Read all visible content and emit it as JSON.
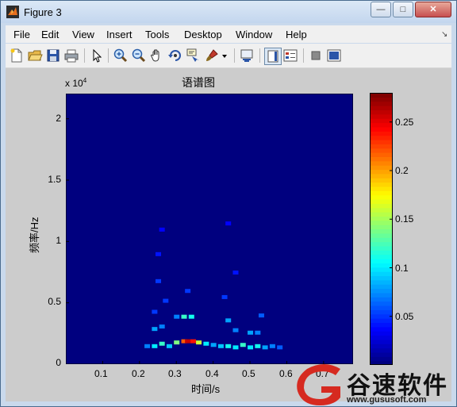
{
  "window": {
    "title": "Figure 3",
    "minimize_label": "—",
    "maximize_label": "□",
    "close_label": "✕"
  },
  "menubar": {
    "items": [
      "File",
      "Edit",
      "View",
      "Insert",
      "Tools",
      "Desktop",
      "Window",
      "Help"
    ],
    "dock_arrow": "↘"
  },
  "toolbar": {
    "buttons": [
      "new-figure-icon",
      "open-file-icon",
      "save-icon",
      "print-icon",
      "select-pointer-icon",
      "zoom-in-icon",
      "zoom-out-icon",
      "pan-hand-icon",
      "rotate-3d-icon",
      "data-cursor-icon",
      "brush-icon",
      "link-plot-icon",
      "colorbar-icon",
      "legend-icon",
      "hide-plot-tools-icon",
      "show-plot-tools-icon"
    ]
  },
  "chart_data": {
    "type": "heatmap",
    "title": "语谱图",
    "xlabel": "时间/s",
    "ylabel": "频率/Hz",
    "y_exponent_label": "x 10",
    "y_exponent": "4",
    "xlim": [
      0,
      0.78
    ],
    "ylim": [
      0,
      22050
    ],
    "x_ticks": [
      "0.1",
      "0.2",
      "0.3",
      "0.4",
      "0.5",
      "0.6",
      "0.7"
    ],
    "x_tick_values": [
      0.1,
      0.2,
      0.3,
      0.4,
      0.5,
      0.6,
      0.7
    ],
    "y_ticks": [
      "0",
      "0.5",
      "1",
      "1.5",
      "2"
    ],
    "y_tick_values": [
      0,
      5000,
      10000,
      15000,
      20000
    ],
    "colormap": "jet",
    "background_color": "#00007f",
    "colorbar": {
      "range": [
        0,
        0.28
      ],
      "ticks": [
        "0.05",
        "0.1",
        "0.15",
        "0.2",
        "0.25"
      ],
      "tick_values": [
        0.05,
        0.1,
        0.15,
        0.2,
        0.25
      ]
    },
    "hotspots": [
      {
        "t": 0.22,
        "f": 1500,
        "v": 0.07
      },
      {
        "t": 0.24,
        "f": 1500,
        "v": 0.1
      },
      {
        "t": 0.26,
        "f": 1700,
        "v": 0.12
      },
      {
        "t": 0.28,
        "f": 1500,
        "v": 0.09
      },
      {
        "t": 0.3,
        "f": 1800,
        "v": 0.14
      },
      {
        "t": 0.32,
        "f": 1900,
        "v": 0.22
      },
      {
        "t": 0.33,
        "f": 1900,
        "v": 0.26
      },
      {
        "t": 0.345,
        "f": 1900,
        "v": 0.24
      },
      {
        "t": 0.36,
        "f": 1800,
        "v": 0.16
      },
      {
        "t": 0.38,
        "f": 1700,
        "v": 0.1
      },
      {
        "t": 0.4,
        "f": 1600,
        "v": 0.08
      },
      {
        "t": 0.42,
        "f": 1500,
        "v": 0.09
      },
      {
        "t": 0.44,
        "f": 1500,
        "v": 0.11
      },
      {
        "t": 0.46,
        "f": 1400,
        "v": 0.1
      },
      {
        "t": 0.48,
        "f": 1600,
        "v": 0.12
      },
      {
        "t": 0.5,
        "f": 1400,
        "v": 0.1
      },
      {
        "t": 0.52,
        "f": 1500,
        "v": 0.11
      },
      {
        "t": 0.54,
        "f": 1400,
        "v": 0.08
      },
      {
        "t": 0.56,
        "f": 1500,
        "v": 0.07
      },
      {
        "t": 0.58,
        "f": 1400,
        "v": 0.06
      },
      {
        "t": 0.24,
        "f": 2900,
        "v": 0.08
      },
      {
        "t": 0.26,
        "f": 3100,
        "v": 0.07
      },
      {
        "t": 0.32,
        "f": 3900,
        "v": 0.12
      },
      {
        "t": 0.34,
        "f": 3900,
        "v": 0.11
      },
      {
        "t": 0.3,
        "f": 3900,
        "v": 0.07
      },
      {
        "t": 0.44,
        "f": 3600,
        "v": 0.08
      },
      {
        "t": 0.46,
        "f": 2800,
        "v": 0.07
      },
      {
        "t": 0.5,
        "f": 2600,
        "v": 0.08
      },
      {
        "t": 0.52,
        "f": 2600,
        "v": 0.07
      },
      {
        "t": 0.53,
        "f": 4000,
        "v": 0.06
      },
      {
        "t": 0.24,
        "f": 4300,
        "v": 0.05
      },
      {
        "t": 0.27,
        "f": 5200,
        "v": 0.05
      },
      {
        "t": 0.25,
        "f": 6800,
        "v": 0.05
      },
      {
        "t": 0.33,
        "f": 6000,
        "v": 0.05
      },
      {
        "t": 0.43,
        "f": 5500,
        "v": 0.05
      },
      {
        "t": 0.46,
        "f": 7500,
        "v": 0.04
      },
      {
        "t": 0.25,
        "f": 9000,
        "v": 0.04
      },
      {
        "t": 0.44,
        "f": 11500,
        "v": 0.035
      },
      {
        "t": 0.26,
        "f": 11000,
        "v": 0.035
      }
    ]
  },
  "watermark": {
    "brand": "谷速软件",
    "url": "www.gususoft.com"
  }
}
